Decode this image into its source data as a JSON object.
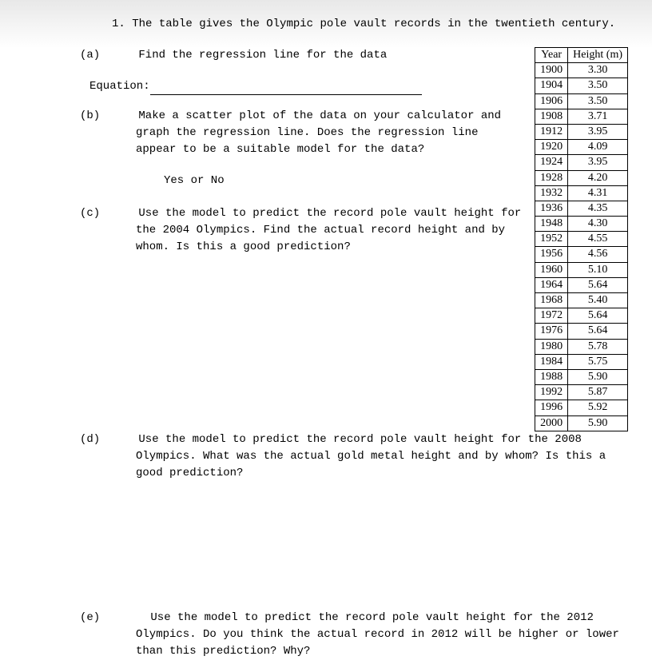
{
  "question_number": "1.",
  "intro": "The table gives the Olympic pole vault records in the twentieth century.",
  "parts": {
    "a": {
      "label": "(a)",
      "text": "Find the regression line for the data"
    },
    "equation_label": "Equation:",
    "b": {
      "label": "(b)",
      "text": "Make a scatter plot of the data on your calculator and graph the regression line. Does the regression line appear to be a suitable model for the data?"
    },
    "yes_no": "Yes or No",
    "c": {
      "label": "(c)",
      "text": "Use the model to predict the record pole vault height for the 2004 Olympics. Find the actual record height and by whom. Is this a good prediction?"
    },
    "d": {
      "label": "(d)",
      "text": "Use the model to predict the record pole vault height for the 2008 Olympics. What was the actual gold metal height and by whom? Is this a good prediction?"
    },
    "e": {
      "label": "(e)",
      "text": "Use the model to predict the record pole vault height for the 2012 Olympics. Do you think the actual record in 2012 will be higher or lower than this prediction? Why?"
    }
  },
  "table": {
    "headers": [
      "Year",
      "Height (m)"
    ],
    "rows": [
      [
        "1900",
        "3.30"
      ],
      [
        "1904",
        "3.50"
      ],
      [
        "1906",
        "3.50"
      ],
      [
        "1908",
        "3.71"
      ],
      [
        "1912",
        "3.95"
      ],
      [
        "1920",
        "4.09"
      ],
      [
        "1924",
        "3.95"
      ],
      [
        "1928",
        "4.20"
      ],
      [
        "1932",
        "4.31"
      ],
      [
        "1936",
        "4.35"
      ],
      [
        "1948",
        "4.30"
      ],
      [
        "1952",
        "4.55"
      ],
      [
        "1956",
        "4.56"
      ],
      [
        "1960",
        "5.10"
      ],
      [
        "1964",
        "5.64"
      ],
      [
        "1968",
        "5.40"
      ],
      [
        "1972",
        "5.64"
      ],
      [
        "1976",
        "5.64"
      ],
      [
        "1980",
        "5.78"
      ],
      [
        "1984",
        "5.75"
      ],
      [
        "1988",
        "5.90"
      ],
      [
        "1992",
        "5.87"
      ],
      [
        "1996",
        "5.92"
      ],
      [
        "2000",
        "5.90"
      ]
    ]
  },
  "chart_data": {
    "type": "table",
    "title": "Olympic pole vault records",
    "columns": [
      "Year",
      "Height (m)"
    ],
    "data": [
      {
        "Year": 1900,
        "Height (m)": 3.3
      },
      {
        "Year": 1904,
        "Height (m)": 3.5
      },
      {
        "Year": 1906,
        "Height (m)": 3.5
      },
      {
        "Year": 1908,
        "Height (m)": 3.71
      },
      {
        "Year": 1912,
        "Height (m)": 3.95
      },
      {
        "Year": 1920,
        "Height (m)": 4.09
      },
      {
        "Year": 1924,
        "Height (m)": 3.95
      },
      {
        "Year": 1928,
        "Height (m)": 4.2
      },
      {
        "Year": 1932,
        "Height (m)": 4.31
      },
      {
        "Year": 1936,
        "Height (m)": 4.35
      },
      {
        "Year": 1948,
        "Height (m)": 4.3
      },
      {
        "Year": 1952,
        "Height (m)": 4.55
      },
      {
        "Year": 1956,
        "Height (m)": 4.56
      },
      {
        "Year": 1960,
        "Height (m)": 5.1
      },
      {
        "Year": 1964,
        "Height (m)": 5.64
      },
      {
        "Year": 1968,
        "Height (m)": 5.4
      },
      {
        "Year": 1972,
        "Height (m)": 5.64
      },
      {
        "Year": 1976,
        "Height (m)": 5.64
      },
      {
        "Year": 1980,
        "Height (m)": 5.78
      },
      {
        "Year": 1984,
        "Height (m)": 5.75
      },
      {
        "Year": 1988,
        "Height (m)": 5.9
      },
      {
        "Year": 1992,
        "Height (m)": 5.87
      },
      {
        "Year": 1996,
        "Height (m)": 5.92
      },
      {
        "Year": 2000,
        "Height (m)": 5.9
      }
    ]
  }
}
